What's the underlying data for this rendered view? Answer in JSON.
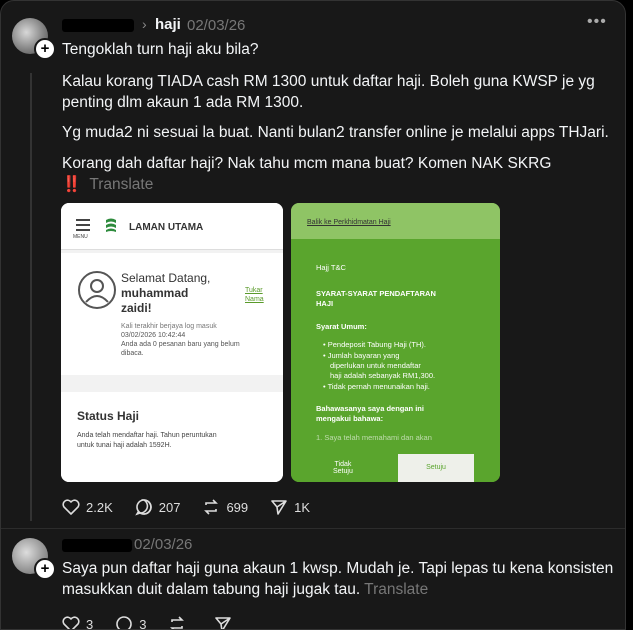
{
  "post": {
    "author_tag": "haji",
    "separator": "›",
    "date": "02/03/26",
    "lines": [
      "Tengoklah turn haji aku bila?",
      "Kalau korang TIADA cash RM 1300 untuk daftar haji. Boleh guna KWSP je yg",
      "penting dlm akaun 1 ada RM 1300.",
      "Yg muda2 ni sesuai la buat. Nanti bulan2 transfer online je melalui apps THJari.",
      "Korang dah daftar haji? Nak tahu mcm mana buat? Komen NAK SKRG"
    ],
    "emoji": "‼️",
    "translate": "Translate",
    "actions": {
      "likes": "2.2K",
      "comments": "207",
      "reposts": "699",
      "shares": "1K"
    },
    "image1": {
      "menu": "MENU",
      "logo_text": "TH JARI",
      "title": "LAMAN UTAMA",
      "greeting1": "Selamat Datang,",
      "greeting2": "muhammad",
      "greeting3": "zaidi!",
      "change_name1": "Tukar",
      "change_name2": "Nama",
      "last_login": "Kali terakhir berjaya log masuk",
      "last_login_time": "03/02/2026 10:42:44",
      "messages1": "Anda ada 0 pesanan baru yang belum",
      "messages2": "dibaca.",
      "status_title": "Status Haji",
      "status_text1": "Anda telah mendaftar haji. Tahun peruntukan",
      "status_text2": "untuk tunai haji adalah 1592H."
    },
    "image2": {
      "back": "Balik ke Perkhidmatan Haji",
      "heading": "Hajj T&C",
      "sub1": "SYARAT-SYARAT PENDAFTARAN",
      "sub2": "HAJI",
      "general": "Syarat Umum:",
      "b1": "Pendeposit Tabung Haji (TH).",
      "b2a": "Jumlah bayaran yang",
      "b2b": "diperlukan untuk mendaftar",
      "b2c": "haji adalah sebanyak RM1,300.",
      "b3": "Tidak pernah menunaikan haji.",
      "decl1": "Bahawasanya saya dengan ini",
      "decl2": "mengakui bahawa:",
      "point": "1. Saya telah memahami dan akan",
      "disagree1": "Tidak",
      "disagree2": "Setuju",
      "agree": "Setuju"
    }
  },
  "reply": {
    "date": "02/03/26",
    "line1": "Saya pun daftar haji guna akaun 1 kwsp. Mudah je. Tapi lepas tu kena konsisten",
    "line2": "masukkan duit dalam tabung haji jugak tau.",
    "translate": "Translate",
    "actions": {
      "likes": "3",
      "comments": "3"
    }
  }
}
